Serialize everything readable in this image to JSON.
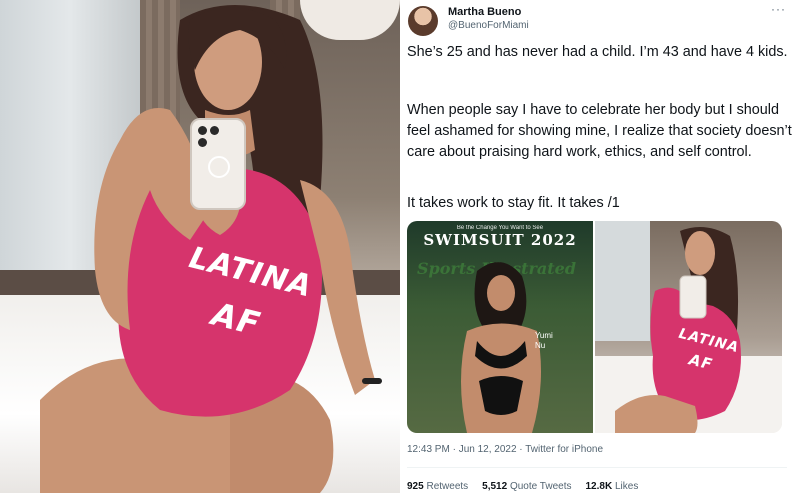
{
  "tweet": {
    "author_name": "Martha Bueno",
    "author_handle": "@BuenoForMiami",
    "more_label": "···",
    "paragraphs": [
      "She’s 25 and has never had a child. I’m 43 and have 4 kids.",
      "When people say I have to celebrate her body but I should feel ashamed for showing mine, I realize that society doesn’t care about praising hard work, ethics, and self control.",
      "It takes work to stay fit. It takes /1"
    ],
    "meta": "12:43 PM · Jun 12, 2022 · Twitter for iPhone",
    "stats": {
      "retweets_count": "925",
      "retweets_label": "Retweets",
      "quotes_count": "5,512",
      "quotes_label": "Quote Tweets",
      "likes_count": "12.8K",
      "likes_label": "Likes"
    }
  },
  "photo": {
    "swimsuit_text_line1": "LATINA",
    "swimsuit_text_line2": "AF"
  },
  "magazine": {
    "tagline": "Be the Change You Want to See",
    "title": "SWIMSUIT 2022",
    "masthead": "Sports Illustrated",
    "cover_name_line1": "Yumi",
    "cover_name_line2": "Nu"
  },
  "colors": {
    "swimsuit": "#d6346c",
    "text_primary": "#0f1419",
    "text_secondary": "#536471"
  }
}
